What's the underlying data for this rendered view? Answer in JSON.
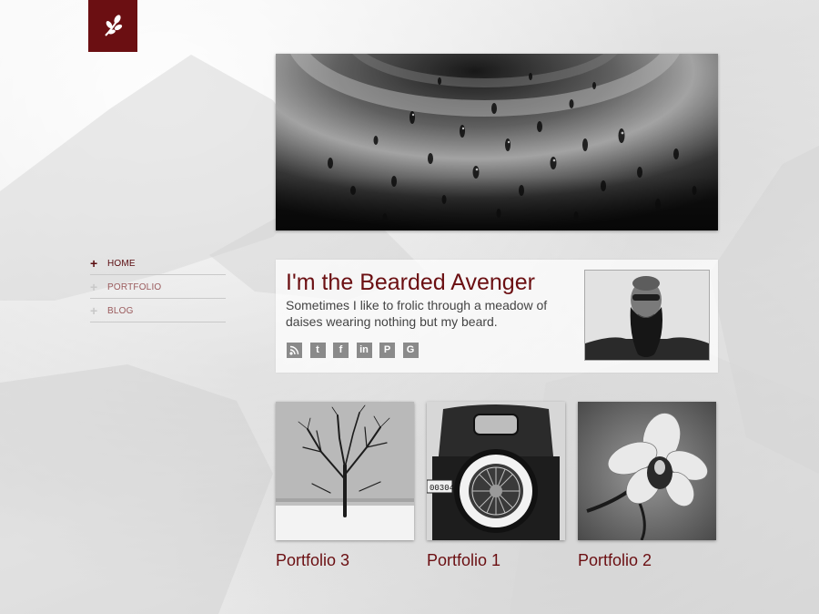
{
  "brand": {
    "logo_icon": "leaf-branch-icon",
    "color": "#6b0f12"
  },
  "nav": {
    "items": [
      {
        "label": "HOME",
        "icon": "plus-icon",
        "active": true
      },
      {
        "label": "PORTFOLIO",
        "icon": "plus-icon",
        "active": false
      },
      {
        "label": "BLOG",
        "icon": "plus-icon",
        "active": false
      }
    ]
  },
  "about": {
    "title": "I'm the Bearded Avenger",
    "text": "Sometimes I like to frolic through a meadow of daises wearing nothing but my beard.",
    "social": [
      "rss-icon",
      "twitter-icon",
      "facebook-icon",
      "linkedin-icon",
      "pinterest-icon",
      "google-icon"
    ]
  },
  "portfolio": [
    {
      "title": "Portfolio 3",
      "image": "snowy-tree"
    },
    {
      "title": "Portfolio 1",
      "image": "vintage-car-spare-wheel"
    },
    {
      "title": "Portfolio 2",
      "image": "orchid-flower"
    }
  ],
  "colors": {
    "accent": "#6b0f12",
    "nav_active": "#5a0c0f",
    "nav_inactive": "#9a5a5c",
    "icon_gray": "#8a8a8a"
  }
}
